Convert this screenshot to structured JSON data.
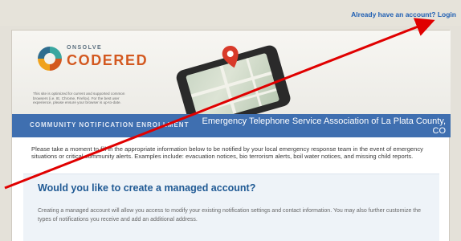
{
  "topbar": {
    "account_prompt": "Already have an account?",
    "login_label": "Login"
  },
  "logo": {
    "on": "ONSOLVE",
    "codered": "CODERED",
    "colors": {
      "brand_orange": "#d3581f",
      "brand_teal": "#3aa7a0"
    }
  },
  "disclaimer": "This site is optimized for current and supported common browsers (i.e. IE, Chrome, Firefox). For the best user experience, please ensure your browser is up-to-date.",
  "banner": {
    "label": "COMMUNITY NOTIFICATION ENROLLMENT",
    "title": "Emergency Telephone Service Association of La Plata County, CO"
  },
  "intro": "Please take a moment to fill in the appropriate information below to be notified by your local emergency response team in the event of emergency situations or critical community alerts. Examples include: evacuation notices, bio terrorism alerts, boil water notices, and missing child reports.",
  "managed": {
    "heading": "Would you like to create a managed account?",
    "text": "Creating a managed account will allow you access to modify your existing notification settings and contact information. You may also further customize the types of notifications you receive and add an additional address."
  },
  "annotation": {
    "arrow_color": "#e00000"
  }
}
